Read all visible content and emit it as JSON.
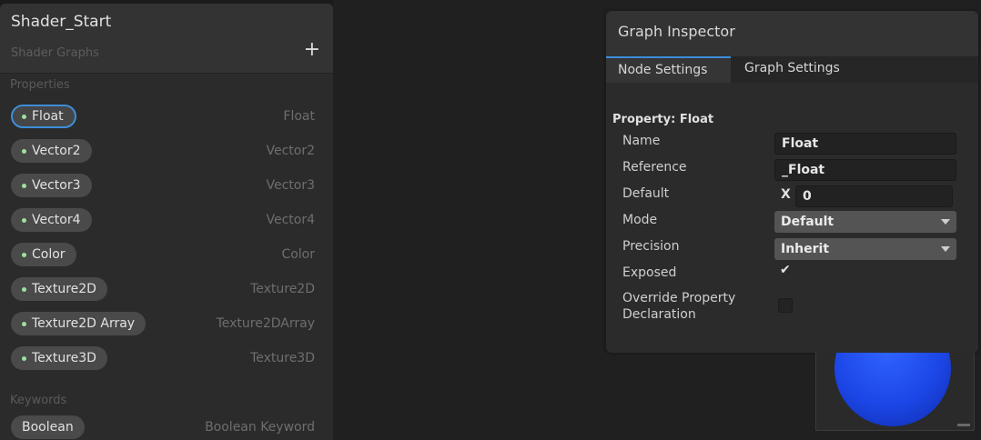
{
  "blackboard": {
    "title": "Shader_Start",
    "subtitle": "Shader Graphs",
    "add_icon": "plus-icon",
    "sections": {
      "properties_label": "Properties",
      "keywords_label": "Keywords"
    },
    "properties": [
      {
        "name": "Float",
        "type": "Float",
        "selected": true
      },
      {
        "name": "Vector2",
        "type": "Vector2"
      },
      {
        "name": "Vector3",
        "type": "Vector3"
      },
      {
        "name": "Vector4",
        "type": "Vector4"
      },
      {
        "name": "Color",
        "type": "Color"
      },
      {
        "name": "Texture2D",
        "type": "Texture2D"
      },
      {
        "name": "Texture2D Array",
        "type": "Texture2DArray"
      },
      {
        "name": "Texture3D",
        "type": "Texture3D"
      }
    ],
    "keywords": [
      {
        "name": "Boolean",
        "type": "Boolean Keyword"
      }
    ]
  },
  "inspector": {
    "title": "Graph Inspector",
    "tabs": [
      "Node Settings",
      "Graph Settings"
    ],
    "active_tab": "Node Settings",
    "property_title": "Property: Float",
    "fields": {
      "name_label": "Name",
      "name_value": "Float",
      "reference_label": "Reference",
      "reference_value": "_Float",
      "default_label": "Default",
      "default_axis": "X",
      "default_value": "0",
      "mode_label": "Mode",
      "mode_value": "Default",
      "precision_label": "Precision",
      "precision_value": "Inherit",
      "exposed_label": "Exposed",
      "exposed_checked": true,
      "exposed_check_glyph": "✔",
      "override_label_line1": "Override Property",
      "override_label_line2": "Declaration",
      "override_checked": false
    }
  },
  "colors": {
    "accent": "#3d8dd8",
    "property_dot": "#9ce29c",
    "preview_sphere": "#1c46e6"
  }
}
